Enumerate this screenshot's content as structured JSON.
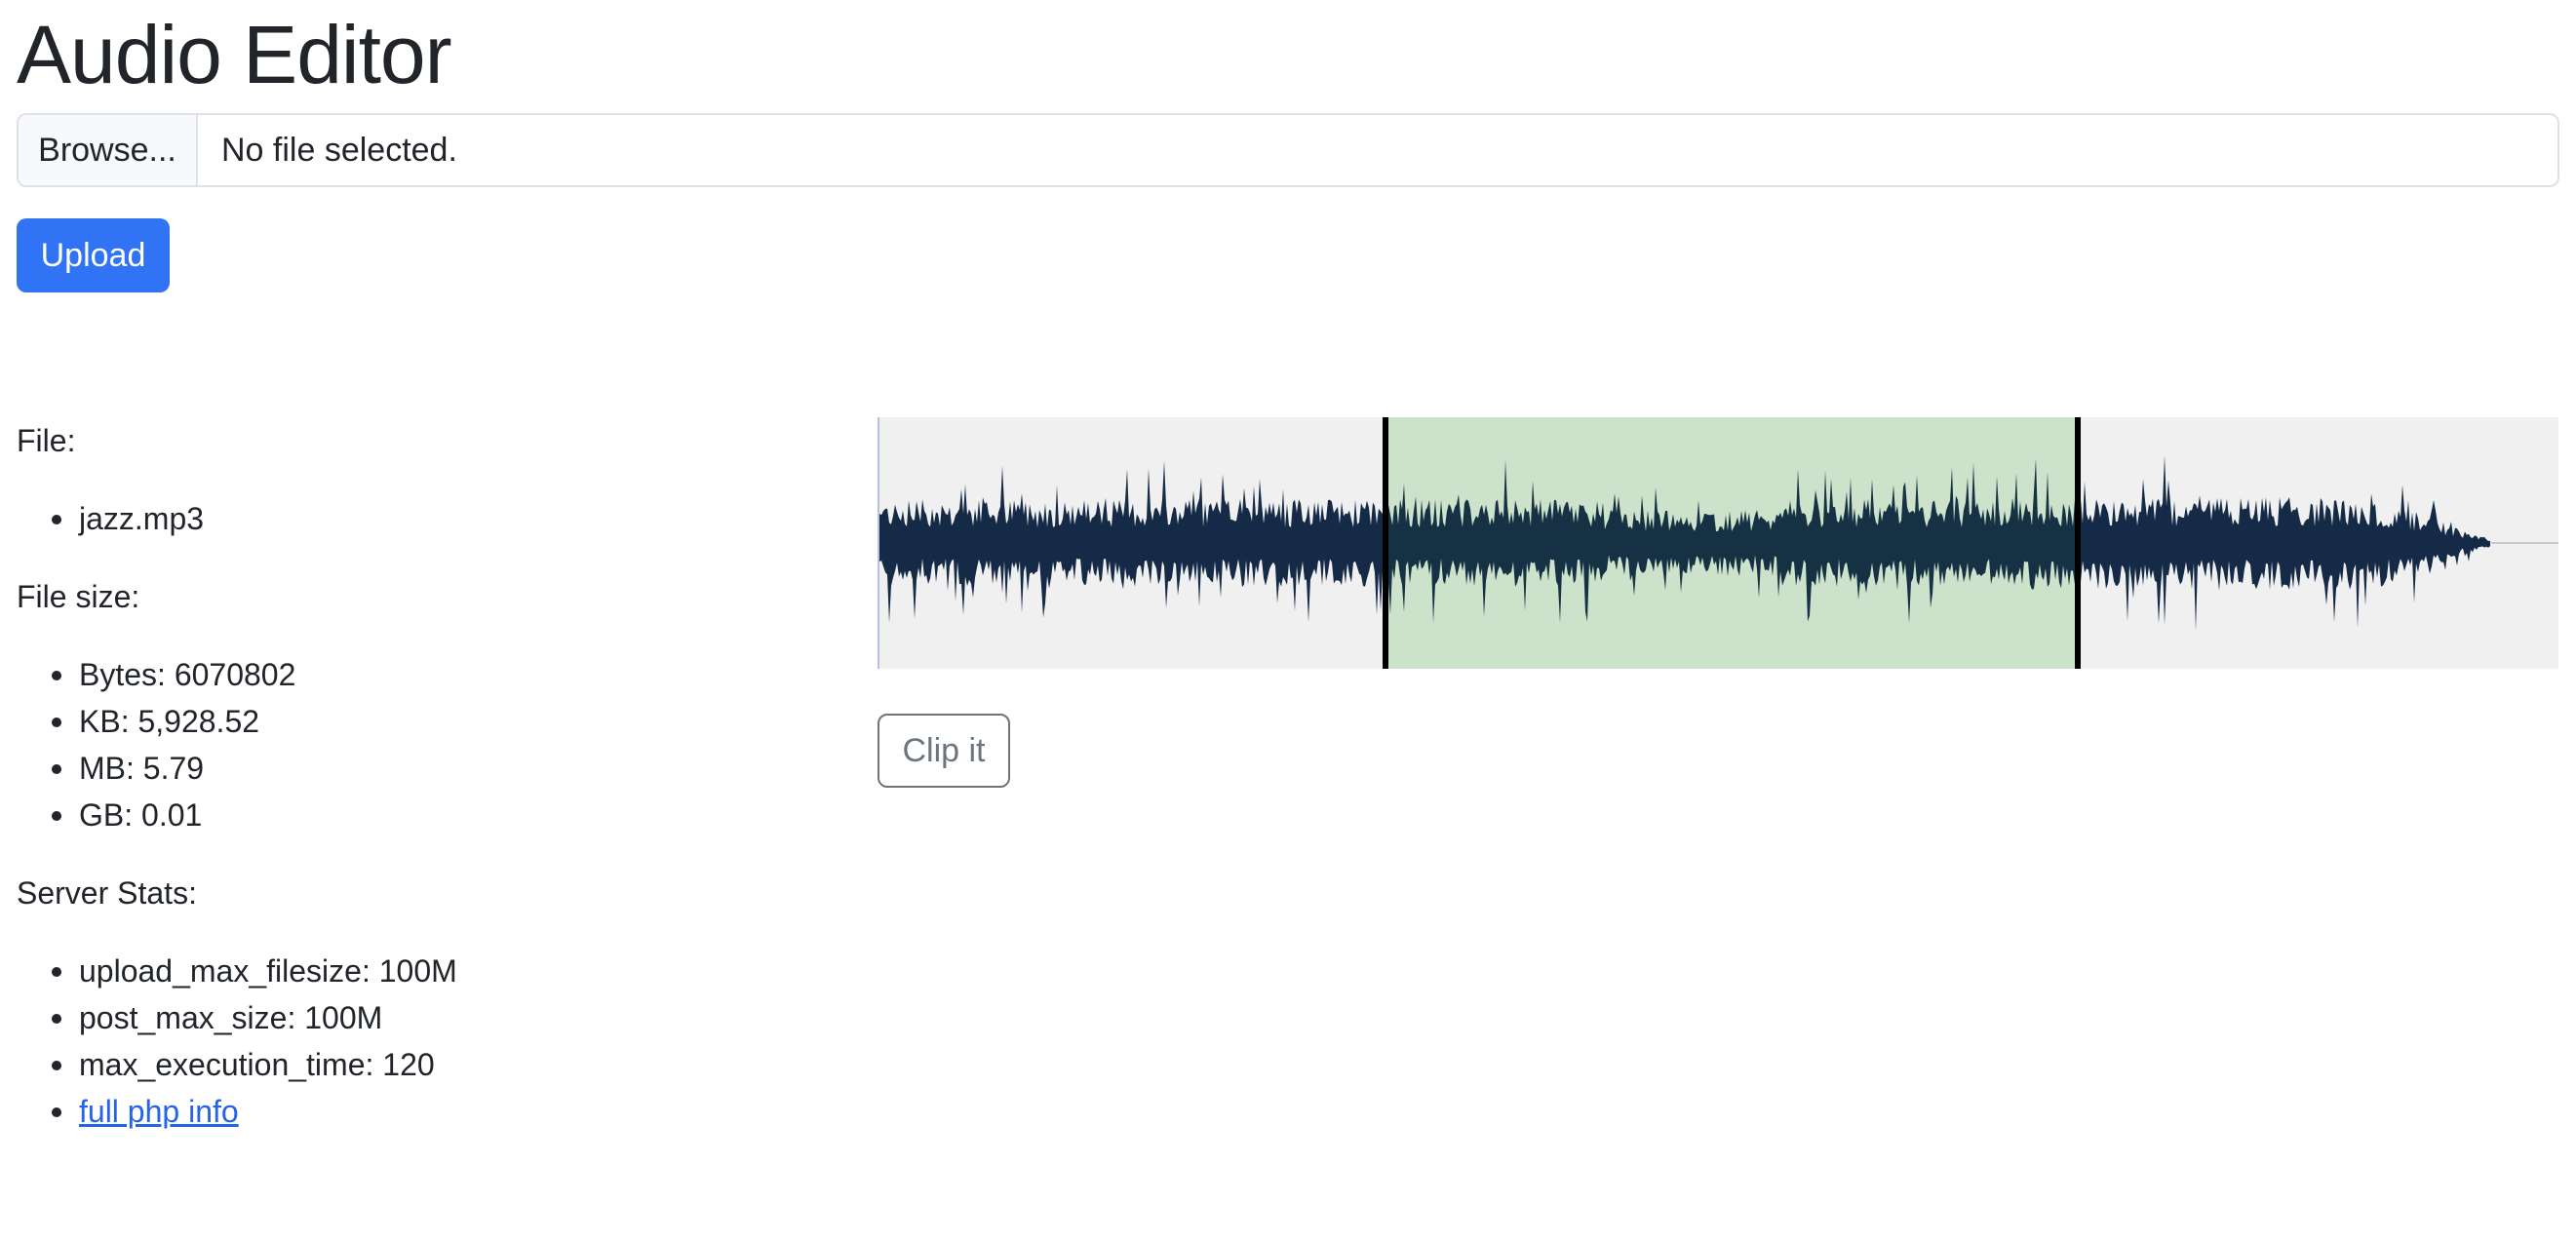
{
  "title": "Audio Editor",
  "file_input": {
    "browse_label": "Browse...",
    "status": "No file selected."
  },
  "upload_label": "Upload",
  "file_section": {
    "heading": "File:",
    "items": [
      "jazz.mp3"
    ]
  },
  "size_section": {
    "heading": "File size:",
    "items": [
      "Bytes: 6070802",
      "KB: 5,928.52",
      "MB: 5.79",
      "GB: 0.01"
    ]
  },
  "server_section": {
    "heading": "Server Stats:",
    "items": [
      "upload_max_filesize: 100M",
      "post_max_size: 100M",
      "max_execution_time: 120"
    ],
    "link_label": "full php info"
  },
  "waveform": {
    "selection_start_fraction": 0.302,
    "selection_end_fraction": 0.714,
    "audio_end_fraction": 0.96,
    "wave_color": "#142a46",
    "selection_color": "#e2f3df",
    "background_color": "#f0f0f0"
  },
  "clip_label": "Clip it",
  "colors": {
    "primary": "#3173f5",
    "link": "#2563eb",
    "secondary": "#6c757d"
  }
}
